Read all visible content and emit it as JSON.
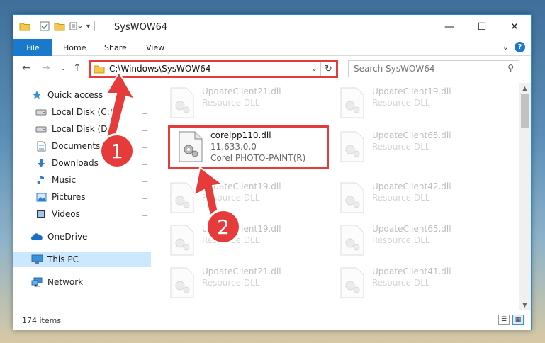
{
  "window": {
    "title": "SysWOW64",
    "controls": {
      "minimize": "—",
      "maximize": "☐",
      "close": "✕"
    }
  },
  "ribbon": {
    "tabs": [
      "File",
      "Home",
      "Share",
      "View"
    ],
    "collapse_glyph": "⌄",
    "help_glyph": "?"
  },
  "navigation": {
    "back": "←",
    "forward": "→",
    "recent": "⌄",
    "up": "↑",
    "address": "C:\\Windows\\SysWOW64",
    "refresh": "↻",
    "search_placeholder": "Search SysWOW64"
  },
  "sidebar": {
    "items": [
      {
        "label": "Quick access",
        "icon": "star-icon",
        "pinned": false
      },
      {
        "label": "Local Disk (C:)",
        "icon": "drive-icon",
        "pinned": true
      },
      {
        "label": "Local Disk (D:)",
        "icon": "drive-icon",
        "pinned": true
      },
      {
        "label": "Documents",
        "icon": "documents-icon",
        "pinned": true
      },
      {
        "label": "Downloads",
        "icon": "download-icon",
        "pinned": true
      },
      {
        "label": "Music",
        "icon": "music-icon",
        "pinned": true
      },
      {
        "label": "Pictures",
        "icon": "pictures-icon",
        "pinned": true
      },
      {
        "label": "Videos",
        "icon": "videos-icon",
        "pinned": true
      },
      {
        "label": "OneDrive",
        "icon": "cloud-icon",
        "pinned": false
      },
      {
        "label": "This PC",
        "icon": "computer-icon",
        "pinned": false,
        "selected": true
      },
      {
        "label": "Network",
        "icon": "network-icon",
        "pinned": false
      }
    ],
    "pin_glyph": "📌"
  },
  "files": {
    "highlighted": {
      "name": "corelpp110.dll",
      "version": "11.633.0.0",
      "company": "Corel PHOTO-PAINT(R)"
    },
    "left_column": [
      {
        "name": "UpdateClient21.dll",
        "type": "Resource DLL"
      },
      {
        "name": "UpdateClient19.dll",
        "type": "Resource DLL"
      },
      {
        "name": "UpdateClient19.dll",
        "type": "Resource DLL"
      },
      {
        "name": "UpdateClient21.dll",
        "type": "Resource DLL"
      }
    ],
    "right_column": [
      {
        "name": "UpdateClient19.dll",
        "type": "Resource DLL"
      },
      {
        "name": "UpdateClient65.dll",
        "type": "Resource DLL"
      },
      {
        "name": "UpdateClient42.dll",
        "type": "Resource DLL"
      },
      {
        "name": "UpdateClient65.dll",
        "type": "Resource DLL"
      },
      {
        "name": "UpdateClient41.dll",
        "type": "Resource DLL"
      }
    ]
  },
  "status": {
    "item_count": "174 items",
    "view_details": "☰",
    "view_tiles": "▦"
  },
  "scrollbar": {
    "up": "▲",
    "down": "▼"
  },
  "callouts": {
    "one": "1",
    "two": "2",
    "color": "#e53b3b"
  },
  "colors": {
    "accent": "#1979ca",
    "selection": "#cce8ff",
    "callout": "#e53b3b"
  }
}
